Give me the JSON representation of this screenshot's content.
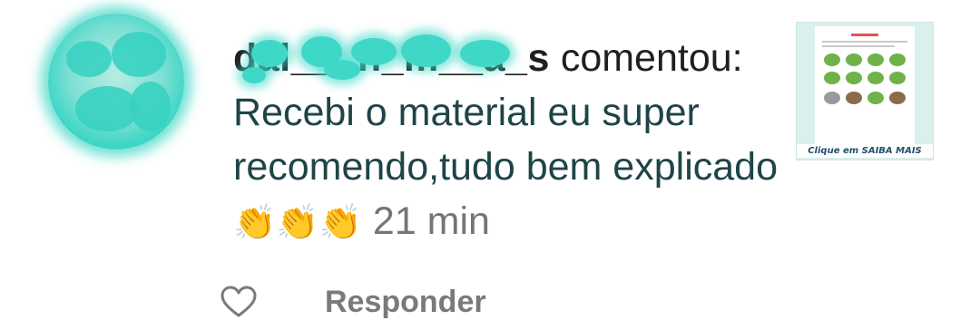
{
  "comment": {
    "username": "dal___n_m__a_s",
    "action": "comentou:",
    "text": "Recebi o material eu super recomendo,tudo bem explicado",
    "emojis": "👏👏👏",
    "time": "21 min"
  },
  "thumbnail": {
    "caption": "Clique em SAIBA MAIS"
  },
  "footer": {
    "like_icon": "heart-outline-icon",
    "reply_label": "Responder"
  },
  "colors": {
    "redaction": "#3fd8c8",
    "text": "#1f4448",
    "muted": "#757575"
  }
}
